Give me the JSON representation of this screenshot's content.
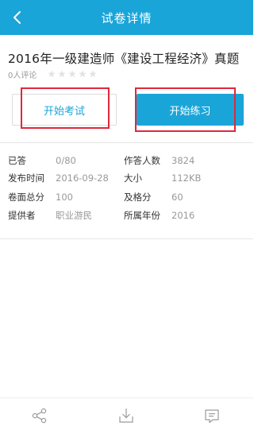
{
  "header": {
    "title": "试卷详情",
    "back_icon": "chevron-left-icon"
  },
  "paper": {
    "title": "2016年一级建造师《建设工程经济》真题",
    "review_count": "0人评论",
    "stars": 0
  },
  "actions": {
    "start_exam": "开始考试",
    "start_practice": "开始练习"
  },
  "info": {
    "answered": {
      "label": "已答",
      "value": "0/80"
    },
    "respondents": {
      "label": "作答人数",
      "value": "3824"
    },
    "publish_time": {
      "label": "发布时间",
      "value": "2016-09-28"
    },
    "size": {
      "label": "大小",
      "value": "112KB"
    },
    "total_score": {
      "label": "卷面总分",
      "value": "100"
    },
    "pass_score": {
      "label": "及格分",
      "value": "60"
    },
    "provider": {
      "label": "提供者",
      "value": "职业游民"
    },
    "year": {
      "label": "所属年份",
      "value": "2016"
    }
  },
  "footer": {
    "icons": [
      "share-icon",
      "download-icon",
      "comment-icon"
    ]
  },
  "colors": {
    "primary": "#1aa5d9",
    "highlight": "#e0283b"
  }
}
